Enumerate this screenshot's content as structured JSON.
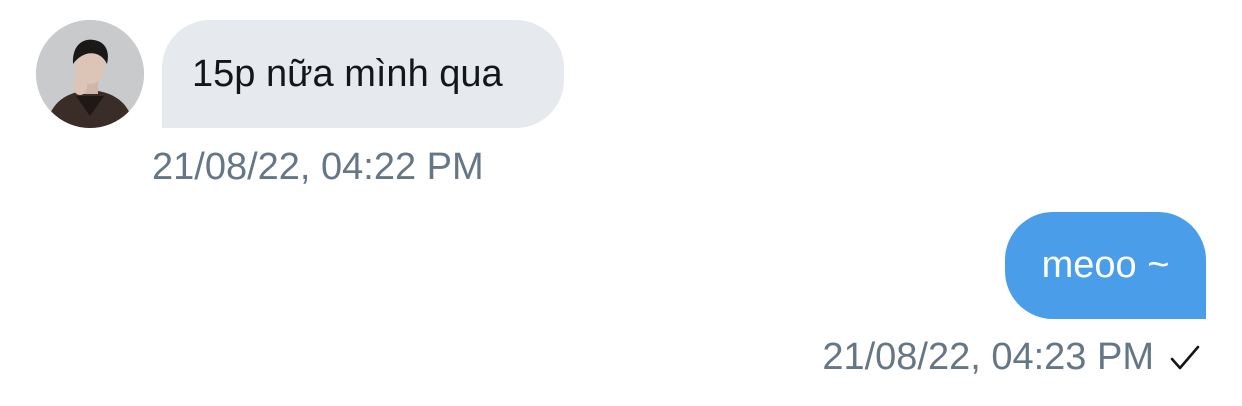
{
  "conversation": {
    "messages": [
      {
        "direction": "incoming",
        "text": "15p nữa mình qua",
        "timestamp": "21/08/22, 04:22 PM",
        "sender_avatar_icon": "user-avatar-photo"
      },
      {
        "direction": "outgoing",
        "text": "meoo ~",
        "timestamp": "21/08/22, 04:23 PM",
        "status_icon": "check-icon"
      }
    ]
  },
  "colors": {
    "incoming_bubble": "#e6e9ee",
    "outgoing_bubble": "#4a9ee9",
    "timestamp_text": "#657786",
    "incoming_text": "#14171a",
    "outgoing_text": "#ffffff"
  }
}
